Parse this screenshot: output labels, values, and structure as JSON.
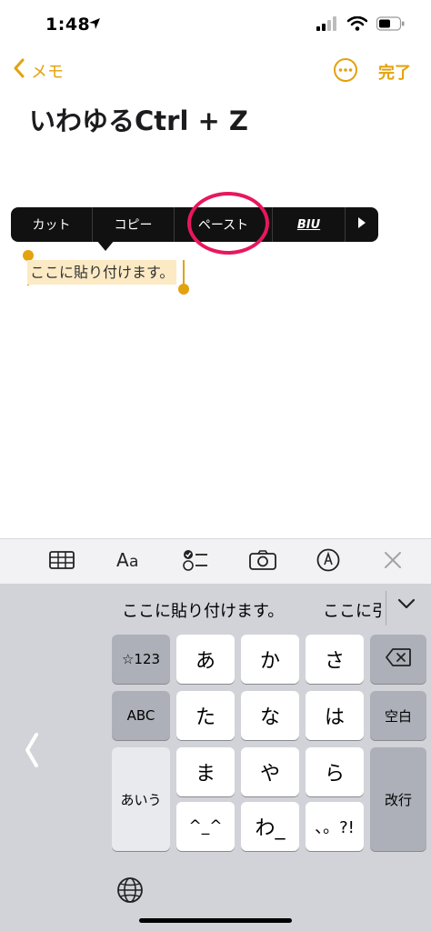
{
  "status": {
    "time": "1:48"
  },
  "nav": {
    "back_label": "メモ",
    "done_label": "完了"
  },
  "note": {
    "title": "いわゆるCtrl + Z",
    "selected_text": "ここに貼り付けます。"
  },
  "edit_menu": {
    "items": [
      {
        "label": "カット"
      },
      {
        "label": "コピー"
      },
      {
        "label": "ペースト"
      },
      {
        "label": "BIU"
      }
    ]
  },
  "keyboard": {
    "candidates": [
      "ここに貼り付けます。",
      "ここに引"
    ],
    "keys": {
      "numbers": "☆123",
      "abc": "ABC",
      "kana": "あいう",
      "a": "あ",
      "ka": "か",
      "sa": "さ",
      "ta": "た",
      "na": "な",
      "ha": "は",
      "ma": "ま",
      "ya": "や",
      "ra": "ら",
      "emoticon": "^_^",
      "wa": "わ_",
      "punct": "、。?!",
      "space": "空白",
      "return": "改行"
    }
  },
  "colors": {
    "accent": "#e3a20e",
    "ring": "#e8175d",
    "menu_bg": "#111111",
    "selection": "#fbeac4"
  }
}
